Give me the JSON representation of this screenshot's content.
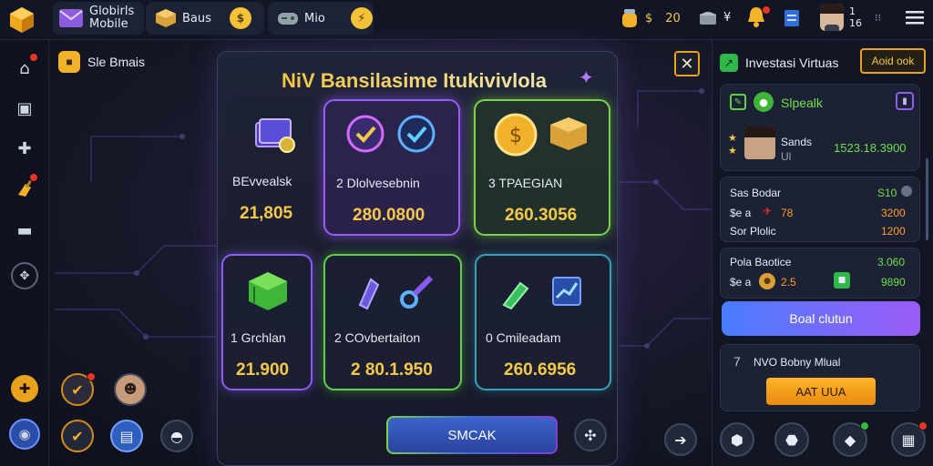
{
  "topbar": {
    "app_name_line1": "Globirls",
    "app_name_line2": "Mobile",
    "tab_1_label": "Baus",
    "tab_2_label": "Mio",
    "coins_label": "$",
    "coins_value": "20",
    "gems_label": "¥",
    "profile_level_top": "1",
    "profile_level_bottom": "16"
  },
  "rail": {
    "header_label": "Sle Bmais"
  },
  "modal": {
    "title": "NiV Bansilasime Itukivivlola",
    "cards": [
      {
        "label": "BEvvealsk",
        "value": "21,805"
      },
      {
        "label": "2  Dlolvesebnin",
        "value": "280.0800"
      },
      {
        "label": "3  TPAEGIAN",
        "value": "260.3056"
      },
      {
        "label": "1  Grchlan",
        "value": "21.900"
      },
      {
        "label": "2  COvbertaiton",
        "value": "2 80.1.950"
      },
      {
        "label": "0  Cmileadam",
        "value": "260.6956"
      }
    ],
    "action_label": "SMCAK"
  },
  "right_panel": {
    "header_label": "Investasi Virtuas",
    "header_button": "Aoid ook",
    "profile_card": {
      "title": "Slpealk",
      "name": "Sands",
      "subtitle": "Ul",
      "amount": "1523.18.3900"
    },
    "stats_card_1": {
      "rows": [
        {
          "label": "Sas Bodar",
          "value": "S10"
        },
        {
          "label": "$e a",
          "mid": "78",
          "value": "3200"
        },
        {
          "label": "Sor Plolic",
          "value": "1200"
        }
      ]
    },
    "stats_card_2": {
      "rows": [
        {
          "label": "Pola Baotice",
          "value": "3.060"
        },
        {
          "label": "$e a",
          "mid": "2.5",
          "value": "9890"
        }
      ]
    },
    "primary_button": "Boal clutun",
    "offer_card": {
      "number": "7",
      "title": "NVO Bobny Mlual",
      "button": "AAT UUA"
    }
  },
  "colors": {
    "accent_gold": "#f4c94a",
    "accent_green": "#6ee04a",
    "accent_orange": "#ff9d2e",
    "card_purple": "#9b5cf6",
    "card_blue": "#4a7cff",
    "card_green": "#7ad44a"
  }
}
